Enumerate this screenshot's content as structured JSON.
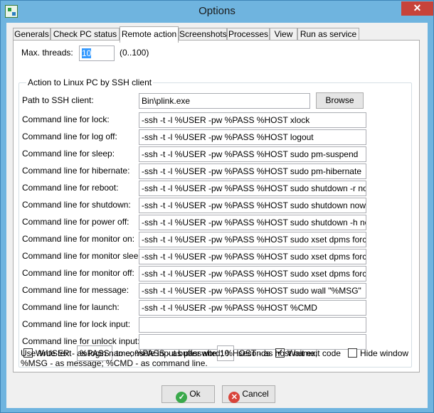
{
  "window": {
    "title": "Options"
  },
  "tabs": [
    "Generals",
    "Check PC status",
    "Remote action",
    "Screenshots",
    "Processes",
    "View",
    "Run as service"
  ],
  "max_threads": {
    "label": "Max. threads:",
    "value": "10",
    "range": "(0..100)"
  },
  "group": {
    "title": "Action to Linux PC by SSH client"
  },
  "ssh_client": {
    "label": "Path to SSH client:",
    "value": "Bin\\plink.exe",
    "browse_label": "Browse"
  },
  "commands": [
    {
      "label": "Command line for lock:",
      "value": "-ssh -t -l %USER -pw %PASS %HOST xlock"
    },
    {
      "label": "Command line for log off:",
      "value": "-ssh -t -l %USER -pw %PASS %HOST logout"
    },
    {
      "label": "Command line for sleep:",
      "value": "-ssh -t -l %USER -pw %PASS %HOST sudo pm-suspend"
    },
    {
      "label": "Command line for hibernate:",
      "value": "-ssh -t -l %USER -pw %PASS %HOST sudo pm-hibernate"
    },
    {
      "label": "Command line for reboot:",
      "value": "-ssh -t -l %USER -pw %PASS %HOST sudo shutdown -r now"
    },
    {
      "label": "Command line for shutdown:",
      "value": "-ssh -t -l %USER -pw %PASS %HOST sudo shutdown now"
    },
    {
      "label": "Command line for power off:",
      "value": "-ssh -t -l %USER -pw %PASS %HOST sudo shutdown -h now"
    },
    {
      "label": "Command line for monitor on:",
      "value": "-ssh -t -l %USER -pw %PASS %HOST sudo xset dpms force on"
    },
    {
      "label": "Command line for monitor sleep:",
      "value": "-ssh -t -l %USER -pw %PASS %HOST sudo xset dpms force stand"
    },
    {
      "label": "Command line for monitor off:",
      "value": "-ssh -t -l %USER -pw %PASS %HOST sudo xset dpms force off"
    },
    {
      "label": "Command line for message:",
      "value": "-ssh -t -l %USER -pw %PASS %HOST sudo wall \"%MSG\""
    },
    {
      "label": "Command line for launch:",
      "value": "-ssh -t -l %USER -pw %PASS %HOST %CMD"
    },
    {
      "label": "Command line for lock input:",
      "value": ""
    },
    {
      "label": "Command line for unlock input:",
      "value": ""
    }
  ],
  "write_text": {
    "checkbox_label": "Write text",
    "text_value": "%PASS",
    "middle_label": "to console input buffer after",
    "seconds_value": "10",
    "seconds_label": "seconds",
    "wait_exit_label": "Wait exit code",
    "hide_window_label": "Hide window",
    "write_checked": "",
    "wait_checked": "✓",
    "hide_checked": ""
  },
  "hint": {
    "line1": "Use %USER - as login name; %PASS - as password; %HOST - as host name;",
    "line2": "%MSG - as message; %CMD - as command line."
  },
  "buttons": {
    "ok": "Ok",
    "cancel": "Cancel",
    "ok_glyph": "✓",
    "cancel_glyph": "✕"
  },
  "titlebar": {
    "close_glyph": "✕"
  }
}
